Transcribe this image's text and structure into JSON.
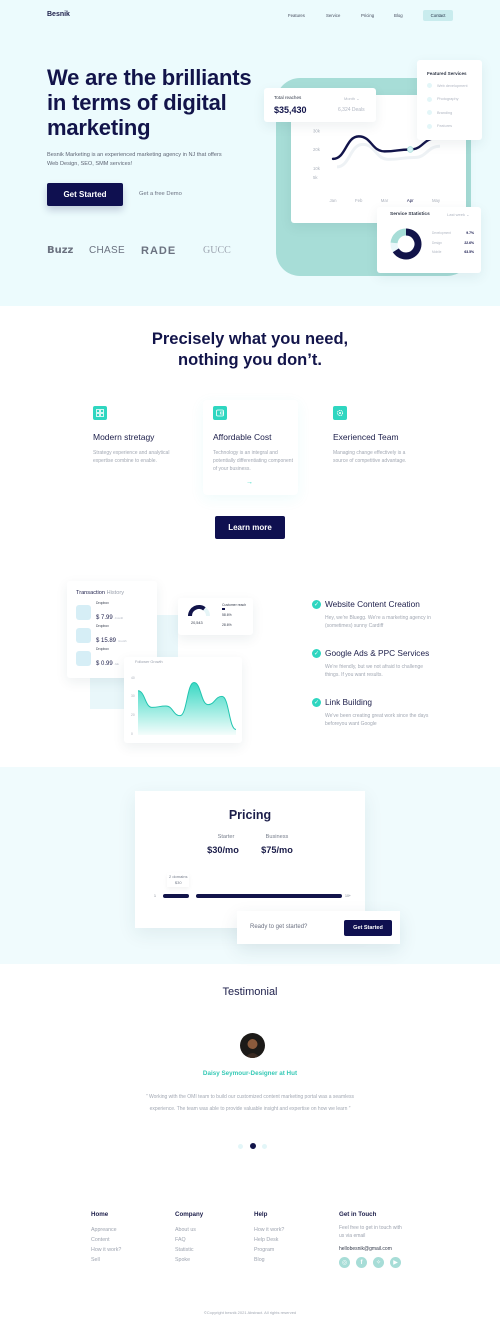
{
  "nav": {
    "logo": "Besnik",
    "links": [
      "Features",
      "Service",
      "Pricing",
      "Blog"
    ],
    "contact_label": "Contact"
  },
  "hero": {
    "title_part1": "We are the brilliants in terms of ",
    "title_highlight": "digital",
    "title_part2": " marketing",
    "subtitle": "Besnik Marketing is an experienced marketing agency in NJ that offers Web Design, SEO, SMM services!",
    "cta_label": "Get Started",
    "demo_label": "Get a free Demo",
    "brands": [
      "Buzz",
      "CHASE",
      "RADE",
      "GUCC"
    ],
    "accent_color": "#3fd1c3"
  },
  "dashboard": {
    "reach": {
      "label": "Total reaches",
      "value": "$35,430",
      "period": "Month",
      "deals": "6,324 Deals"
    },
    "featured": {
      "title": "Featured Services",
      "items": [
        "Web development",
        "Photography",
        "Branding",
        "Features"
      ]
    },
    "stats": {
      "title": "Service Statistics",
      "period": "Last week",
      "rows": [
        {
          "label": "Development",
          "value": "9.7%"
        },
        {
          "label": "Design",
          "value": "22.6%"
        },
        {
          "label": "Mobile",
          "value": "63.5%"
        }
      ]
    }
  },
  "chart_data": [
    {
      "type": "line",
      "title": "Total reaches",
      "categories": [
        "Jan",
        "Feb",
        "Mar",
        "Apr",
        "May"
      ],
      "highlight_category": "Apr",
      "y_ticks": [
        "30k",
        "20k",
        "10k",
        "5k"
      ],
      "ylim": [
        0,
        32000
      ],
      "series": [
        {
          "name": "Reaches",
          "values": [
            15000,
            27000,
            19000,
            20000,
            26000
          ]
        }
      ]
    },
    {
      "type": "pie",
      "title": "Service Statistics",
      "categories": [
        "Development",
        "Design",
        "Mobile"
      ],
      "values": [
        9.7,
        22.6,
        63.5
      ]
    },
    {
      "type": "area",
      "title": "Follower Growth",
      "y_ticks": [
        "40",
        "30",
        "20",
        "0"
      ],
      "series": [
        {
          "name": "Followers",
          "values": [
            32,
            20,
            21,
            14,
            38,
            22,
            28,
            4
          ]
        }
      ]
    }
  ],
  "features": {
    "title_line1": "Precisely what you need,",
    "title_line2": "nothing you don’t.",
    "items": [
      {
        "icon": "grid-icon",
        "title": "Modern stretagy",
        "desc": "Strategy experience and analytical expertise combine to enable."
      },
      {
        "icon": "wallet-icon",
        "title": "Affordable Cost",
        "desc": "Technology is an integral and potentially differentiating component of your business."
      },
      {
        "icon": "gear-icon",
        "title": "Exerienced Team",
        "desc": "Managing change effectively is a source of competitive advantage."
      }
    ],
    "arrow": "→",
    "learn_more_label": "Learn more"
  },
  "transactions": {
    "title_strong": "Transaction",
    "title_light": " History",
    "items": [
      {
        "name": "Dropbox",
        "amount": "$ 7.99",
        "period": "/month"
      },
      {
        "name": "Dropbox",
        "amount": "$ 15.89",
        "period": "/month"
      },
      {
        "name": "Dropbox",
        "amount": "$ 0.99",
        "period": "/wk"
      }
    ],
    "gauge": {
      "value": "20,543",
      "title": "Customer reach",
      "row1": "58.6%",
      "row2": "28.6%"
    },
    "follower_title": "Follower Growth"
  },
  "services": [
    {
      "title": "Website Content Creation",
      "desc": "Hey, we're Bluegg. We're a marketing agency in (sometimes) sunny Cardiff"
    },
    {
      "title": "Google Ads & PPC Services",
      "desc": "We're friendly, but we not afraid to challenge things. If you want results."
    },
    {
      "title": "Link Building",
      "desc": "We've been creating great work since the days beforeyou want Google"
    }
  ],
  "pricing": {
    "title": "Pricing",
    "plans": [
      {
        "name": "Starter",
        "price": "$30/mo"
      },
      {
        "name": "Business",
        "price": "$75/mo"
      }
    ],
    "slider": {
      "min_label": "1",
      "max_label": "10+",
      "tooltip_line1": "2 domains",
      "tooltip_line2": "$30",
      "value_fraction": 0.09
    },
    "ready_text": "Ready to get started?",
    "cta_label": "Get Started"
  },
  "testimonial": {
    "title": "Testimonial",
    "name": "Daisy Seymour-Designer at Hut",
    "quote": "“ Working with the OMI team to build our customized content marketing portal was a seamless experience. The team was able to provide valuable insight and expertise on how we learn ”",
    "active_dot": 1,
    "dot_count": 3
  },
  "footer": {
    "columns": [
      {
        "title": "Home",
        "links": [
          "Appreance",
          "Content",
          "How it work?",
          "Sell"
        ]
      },
      {
        "title": "Company",
        "links": [
          "About us",
          "FAQ",
          "Statistic",
          "Spoke"
        ]
      },
      {
        "title": "Help",
        "links": [
          "How it work?",
          "Help Desk",
          "Program",
          "Blog"
        ]
      }
    ],
    "contact": {
      "title": "Get in Touch",
      "text": "Feel free to get in touch with us via email",
      "email": "hellobesnik@gmail.com",
      "socials": [
        "instagram-icon",
        "facebook-icon",
        "twitter-icon",
        "youtube-icon"
      ]
    },
    "copyright": "©Copyright besnik 2021 Abstract. All rights reserved"
  }
}
